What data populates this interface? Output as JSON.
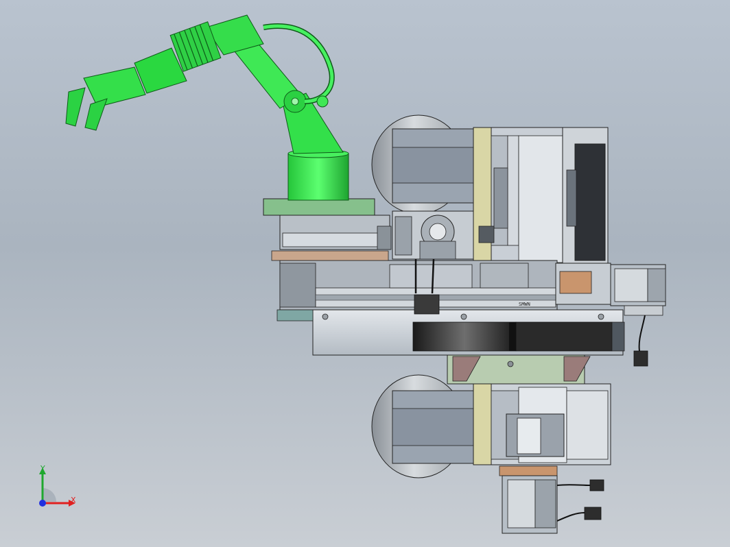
{
  "viewport": {
    "background_top": "#b9c3cf",
    "background_bottom": "#c9ced4"
  },
  "model": {
    "components": [
      "robot-arm",
      "arm-base",
      "base-plate",
      "linear-stage",
      "upper-motor",
      "right-motor",
      "lower-motor",
      "idler-pulley",
      "belt-housing",
      "cable-connectors"
    ],
    "colors": {
      "robot_arm": "#33e04a",
      "robot_arm_shade": "#1fb534",
      "base_plate": "#86c08c",
      "frame": "#c7cfd8",
      "frame_dark": "#6f7984",
      "bracket": "#d8d6a4",
      "copper": "#c9956d",
      "motor": "#b7bfc7",
      "belt": "#2b2b2b"
    },
    "stage_label": "SMWN"
  },
  "triad": {
    "x_label": "X",
    "y_label": "Y",
    "x_color": "#e02020",
    "y_color": "#1fa82f",
    "z_color": "#2030e0"
  }
}
